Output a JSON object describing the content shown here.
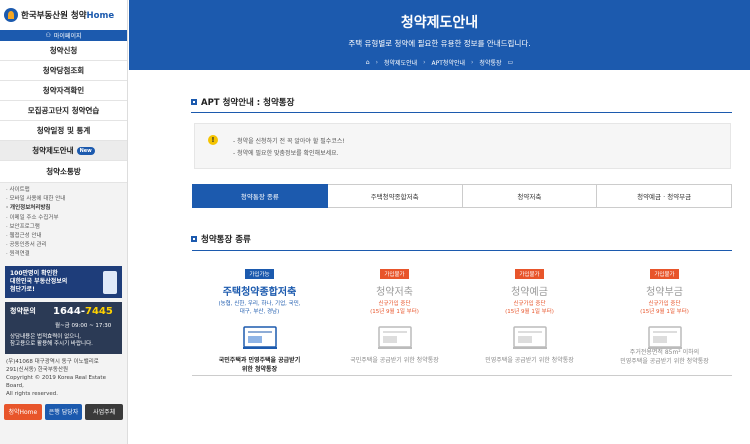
{
  "sidebar": {
    "logo": {
      "brand": "한국부동산원",
      "product": "청약",
      "product_suffix": "Home"
    },
    "mypage_label": "마이페이지",
    "menu": [
      {
        "label": "청약신청"
      },
      {
        "label": "청약당첨조회"
      },
      {
        "label": "청약자격확인"
      },
      {
        "label": "모집공고단지 청약연습"
      },
      {
        "label": "청약일정 및 통계"
      },
      {
        "label": "청약제도안내",
        "badge": "New"
      },
      {
        "label": "청약소통방"
      }
    ],
    "links": [
      "사이트맵",
      "모바일 사용에 대한 안내",
      "개인정보처리방침",
      "이메일 주소 수집거부",
      "보안프로그램",
      "웹접근성 안내",
      "공동인증서 관리",
      "원격연결"
    ],
    "banner": {
      "line1": "100만명이 확인한",
      "line2": "대한민국 부동산정보의",
      "line3": "첨단가로!"
    },
    "contact": {
      "title": "청약문의",
      "number_prefix": "1644-",
      "number_suffix": "7445",
      "hours": "월~금 09:00 ~ 17:30",
      "note1": "상담내용은 법적효력이 없으니,",
      "note2": "참고용으로 활용해 주시기 바랍니다."
    },
    "address": {
      "line1": "(우)41068 대구광역시 동구 이노밸리로",
      "line2": "291(신서동) 한국부동산원",
      "line3": "Copyright © 2019 Korea Real Estate Board,",
      "line4": "All rights reserved."
    },
    "buttons": {
      "home": "청약Home",
      "bank": "은행 담당자",
      "biz": "사업주체"
    }
  },
  "hero": {
    "title": "청약제도안내",
    "subtitle": "주택 유형별로 청약에 필요한 유용한 정보를 안내드립니다.",
    "breadcrumb": [
      "청약제도안내",
      "APT청약안내",
      "청약통장"
    ]
  },
  "section1": {
    "title": "APT 청약안내 : 청약통장"
  },
  "notice": {
    "line1": "- 청약을 신청하기 전 꼭 알아야 할 필수코스!",
    "line2": "- 청약에 필요한 맞춤정보를 확인해보세요."
  },
  "tabs": [
    "청약통장 종류",
    "주택청약종합저축",
    "청약저축",
    "청약예금 · 청약부금"
  ],
  "section2": {
    "title": "청약통장 종류"
  },
  "cards": [
    {
      "tag": "가입가능",
      "name": "주택청약종합저축",
      "desc1": "(농협, 신한, 우리, 하나, 기업, 국민,",
      "desc2": "대구, 부산, 경남)",
      "foot1": "국민주택과 민영주택을 공급받기",
      "foot2": "위한 청약통장"
    },
    {
      "tag": "가입불가",
      "name": "청약저축",
      "desc1": "신규가입 중단",
      "desc2": "(15년 9월 1일 부터)",
      "foot1": "국민주택을 공급받기 위한 청약통장",
      "foot2": ""
    },
    {
      "tag": "가입불가",
      "name": "청약예금",
      "desc1": "신규가입 중단",
      "desc2": "(15년 9월 1일 부터)",
      "foot1": "민영주택을 공급받기 위한 청약통장",
      "foot2": ""
    },
    {
      "tag": "가입불가",
      "name": "청약부금",
      "desc1": "신규가입 중단",
      "desc2": "(15년 9월 1일 부터)",
      "foot1": "주거전용면적 85m² 이하의",
      "foot2": "민영주택을 공급받기 위한 청약통장"
    }
  ],
  "colors": {
    "primary": "#1c5aae",
    "accent": "#e8552b",
    "warning": "#f5c400"
  }
}
